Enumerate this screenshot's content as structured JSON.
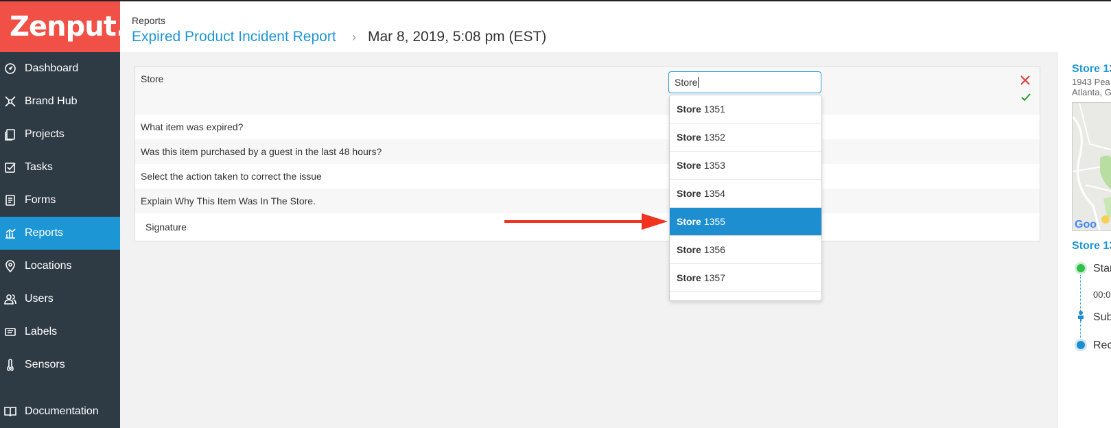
{
  "brand": {
    "logo_text": "Zenput."
  },
  "sidebar": {
    "items": [
      {
        "label": "Dashboard",
        "icon": "dashboard-icon",
        "active": false
      },
      {
        "label": "Brand Hub",
        "icon": "brand-hub-icon",
        "active": false
      },
      {
        "label": "Projects",
        "icon": "projects-icon",
        "active": false
      },
      {
        "label": "Tasks",
        "icon": "tasks-icon",
        "active": false
      },
      {
        "label": "Forms",
        "icon": "forms-icon",
        "active": false
      },
      {
        "label": "Reports",
        "icon": "reports-icon",
        "active": true
      },
      {
        "label": "Locations",
        "icon": "location-pin-icon",
        "active": false
      },
      {
        "label": "Users",
        "icon": "users-icon",
        "active": false
      },
      {
        "label": "Labels",
        "icon": "labels-icon",
        "active": false
      },
      {
        "label": "Sensors",
        "icon": "sensors-icon",
        "active": false
      },
      {
        "label": "Documentation",
        "icon": "book-icon",
        "active": false
      }
    ]
  },
  "header": {
    "breadcrumb": "Reports",
    "report_name": "Expired Product Incident Report",
    "separator": "›",
    "date": "Mar 8, 2019, 5:08 pm (EST)"
  },
  "form": {
    "store_label": "Store",
    "store_input_value": "Store",
    "questions": [
      "What item was expired?",
      "Was this item purchased by a guest in the last 48 hours?",
      "Select the action taken to correct the issue",
      "Explain Why This Item Was In The Store.",
      "Signature"
    ]
  },
  "dropdown": {
    "match_prefix": "Store",
    "options": [
      {
        "number": "1351",
        "selected": false
      },
      {
        "number": "1352",
        "selected": false
      },
      {
        "number": "1353",
        "selected": false
      },
      {
        "number": "1354",
        "selected": false
      },
      {
        "number": "1355",
        "selected": true
      },
      {
        "number": "1356",
        "selected": false
      },
      {
        "number": "1357",
        "selected": false
      },
      {
        "number": "",
        "selected": false
      }
    ]
  },
  "right_panel": {
    "store_title": "Store 13",
    "address_line1": "1943 Pea",
    "address_line2": "Atlanta, G",
    "section_title": "Store 13",
    "timeline_start": "Star",
    "timeline_time": "00:0",
    "timeline_submitted": "Sub",
    "timeline_received": "Rec"
  },
  "colors": {
    "accent": "#1d96d6",
    "sidebar_bg": "#2e3a44",
    "logo_bg": "#f05046",
    "annotation_arrow": "#f0321e",
    "cancel_red": "#e53935",
    "confirm_green": "#2e9e2e"
  }
}
